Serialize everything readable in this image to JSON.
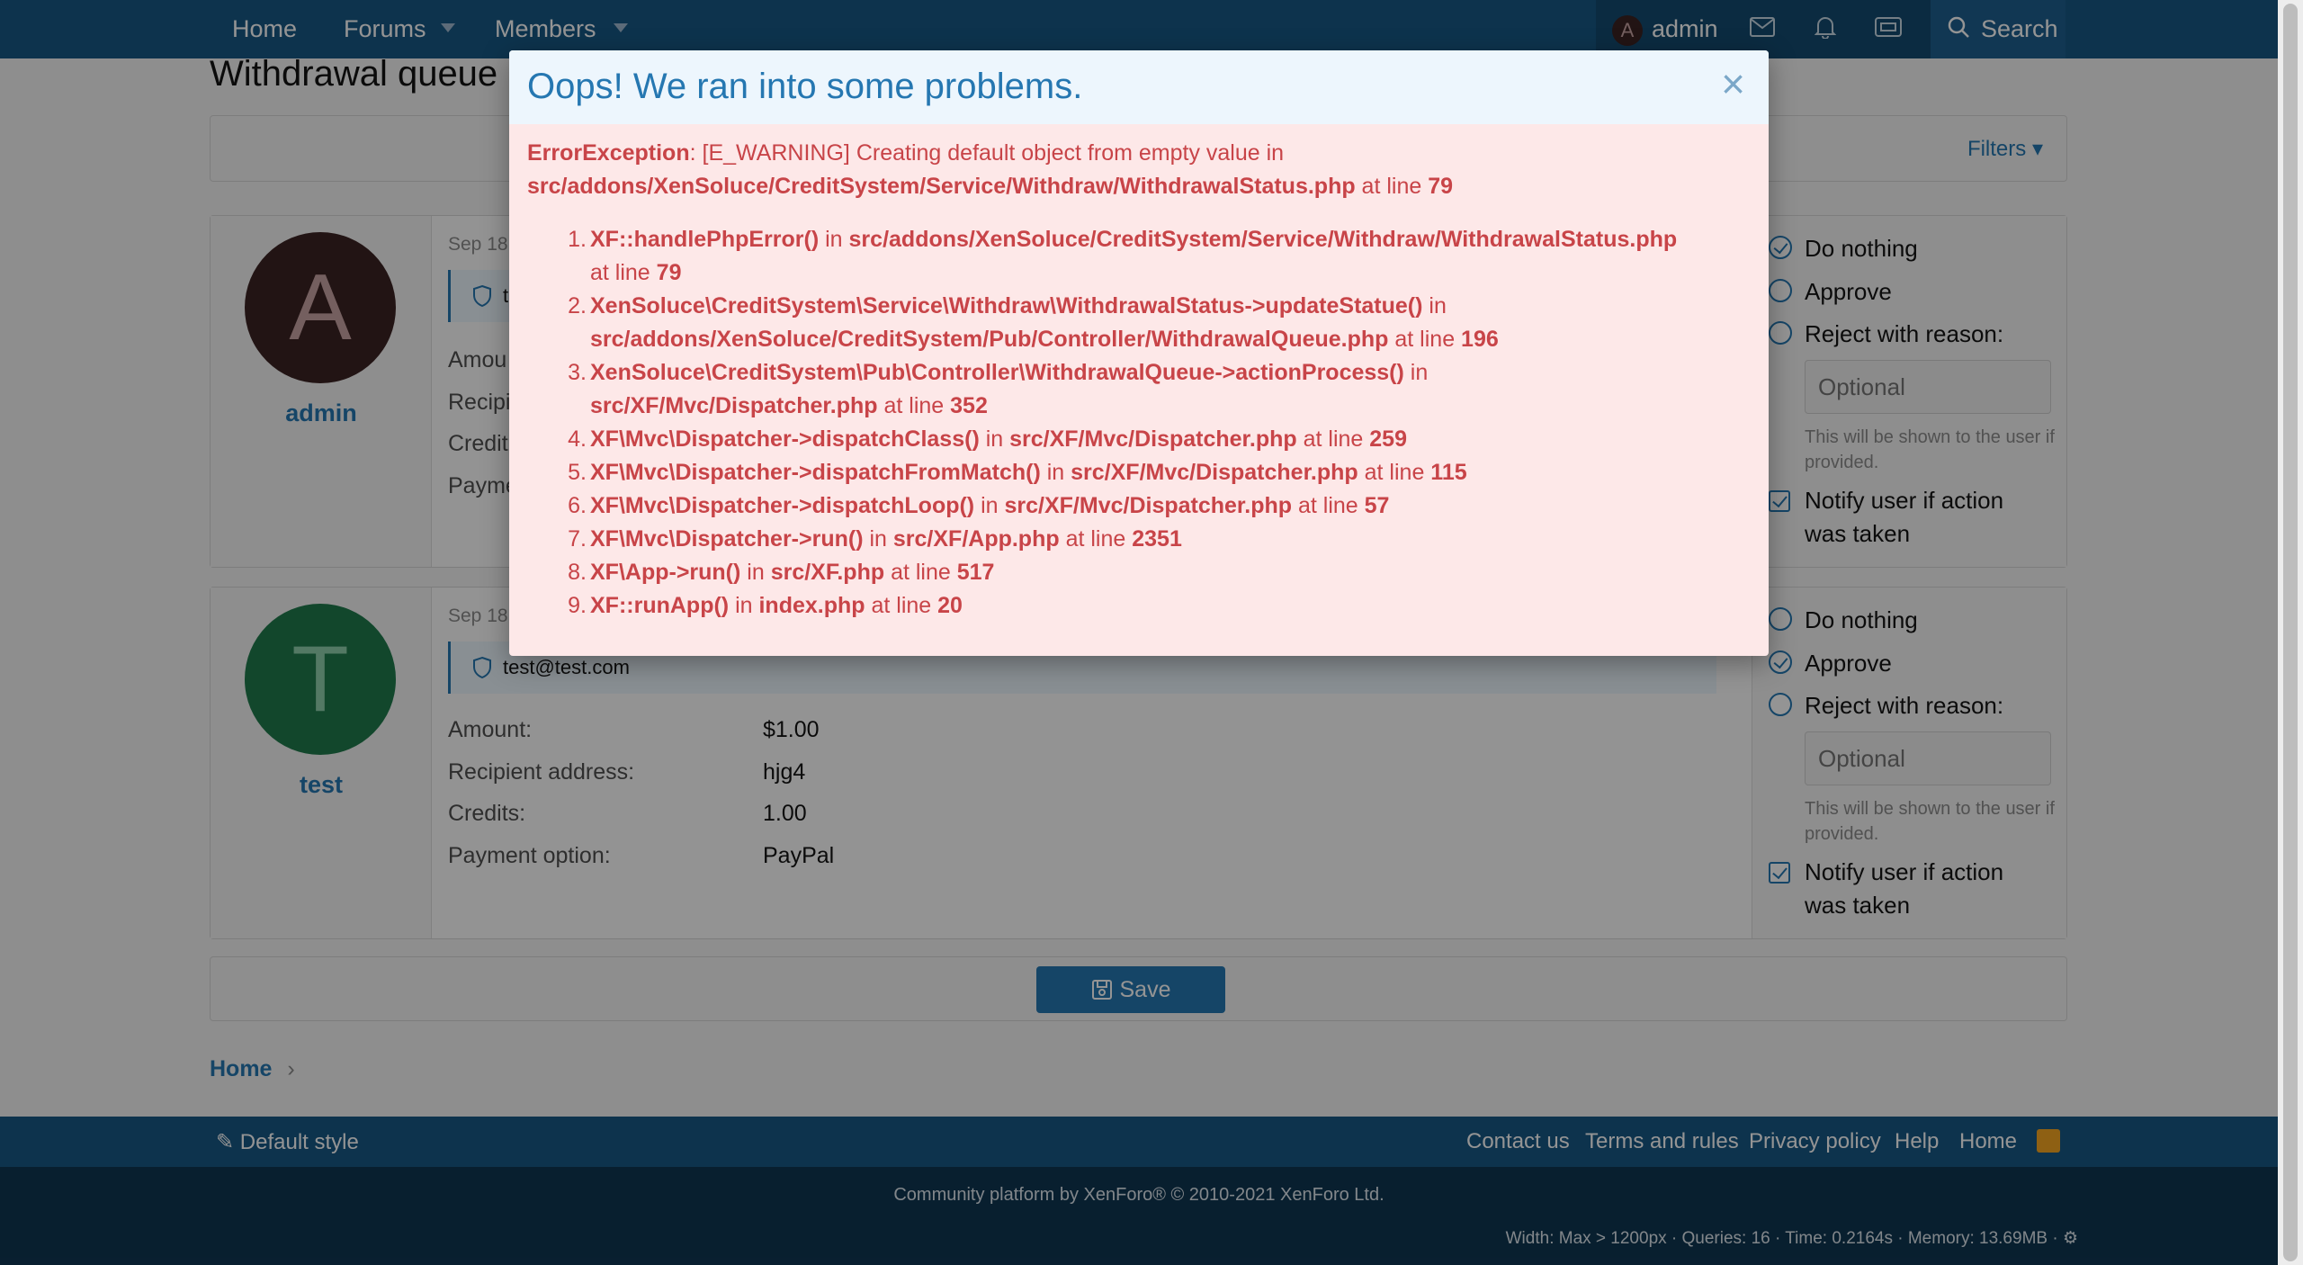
{
  "nav": {
    "home": "Home",
    "forums": "Forums",
    "members": "Members",
    "user_initial": "A",
    "username": "admin",
    "search": "Search",
    "icons": [
      "envelope-icon",
      "bell-icon",
      "ticket-icon",
      "search-icon"
    ]
  },
  "page": {
    "title": "Withdrawal queue",
    "filters": "Filters"
  },
  "items": [
    {
      "initial": "A",
      "username": "admin",
      "avatar_bg": "#3c2323",
      "avatar_fg": "#c9a4a4",
      "date": "Sep 18,",
      "email": "t",
      "labels": [
        "Amou",
        "Recipi",
        "Credit",
        "Payme"
      ],
      "actions": {
        "do_nothing": "Do nothing",
        "approve": "Approve",
        "reject": "Reject with reason:",
        "reason_placeholder": "Optional",
        "hint": "This will be shown to the user if provided.",
        "notify": "Notify user if action was taken",
        "selected": "do_nothing"
      }
    },
    {
      "initial": "T",
      "username": "test",
      "avatar_bg": "#1f7a4c",
      "avatar_fg": "#8fd1ad",
      "date": "Sep 18,",
      "email": "test@test.com",
      "fields": [
        {
          "label": "Amount:",
          "value": "$1.00"
        },
        {
          "label": "Recipient address:",
          "value": "hjg4"
        },
        {
          "label": "Credits:",
          "value": "1.00"
        },
        {
          "label": "Payment option:",
          "value": "PayPal"
        }
      ],
      "actions": {
        "do_nothing": "Do nothing",
        "approve": "Approve",
        "reject": "Reject with reason:",
        "reason_placeholder": "Optional",
        "hint": "This will be shown to the user if provided.",
        "notify": "Notify user if action was taken",
        "selected": "approve"
      }
    }
  ],
  "save": "Save",
  "breadcrumb": "Home",
  "footer": {
    "style": "Default style",
    "links": [
      "Contact us",
      "Terms and rules",
      "Privacy policy",
      "Help",
      "Home"
    ],
    "copyright": "Community platform by XenForo® © 2010-2021 XenForo Ltd.",
    "debug": "Width: Max > 1200px · Queries: 16 · Time: 0.2164s · Memory: 13.69MB · ⚙"
  },
  "modal": {
    "title": "Oops! We ran into some problems.",
    "close": "×",
    "error_type": "ErrorException",
    "error_msg": ": [E_WARNING] Creating default object from empty value in",
    "error_file": "src/addons/XenSoluce/CreditSystem/Service/Withdraw/WithdrawalStatus.php",
    "error_at": " at line ",
    "error_line": "79",
    "trace": [
      {
        "num": "1.",
        "fn": "XF::handlePhpError()",
        "file": "src/addons/XenSoluce/CreditSystem/Service/Withdraw/WithdrawalStatus.php",
        "line": "79"
      },
      {
        "num": "2.",
        "fn": "XenSoluce\\CreditSystem\\Service\\Withdraw\\WithdrawalStatus->updateStatue()",
        "file": "src/addons/XenSoluce/CreditSystem/Pub/Controller/WithdrawalQueue.php",
        "line": "196"
      },
      {
        "num": "3.",
        "fn": "XenSoluce\\CreditSystem\\Pub\\Controller\\WithdrawalQueue->actionProcess()",
        "file": "src/XF/Mvc/Dispatcher.php",
        "line": "352"
      },
      {
        "num": "4.",
        "fn": "XF\\Mvc\\Dispatcher->dispatchClass()",
        "file": "src/XF/Mvc/Dispatcher.php",
        "line": "259"
      },
      {
        "num": "5.",
        "fn": "XF\\Mvc\\Dispatcher->dispatchFromMatch()",
        "file": "src/XF/Mvc/Dispatcher.php",
        "line": "115"
      },
      {
        "num": "6.",
        "fn": "XF\\Mvc\\Dispatcher->dispatchLoop()",
        "file": "src/XF/Mvc/Dispatcher.php",
        "line": "57"
      },
      {
        "num": "7.",
        "fn": "XF\\Mvc\\Dispatcher->run()",
        "file": "src/XF/App.php",
        "line": "2351"
      },
      {
        "num": "8.",
        "fn": "XF\\App->run()",
        "file": "src/XF.php",
        "line": "517"
      },
      {
        "num": "9.",
        "fn": "XF::runApp()",
        "file": "index.php",
        "line": "20"
      }
    ],
    "in_word": " in ",
    "at_line": " at line "
  },
  "colors": {
    "nav_bg": "#185886",
    "accent": "#2577b1",
    "error_text": "#c84448",
    "error_bg": "#fde8e8"
  }
}
